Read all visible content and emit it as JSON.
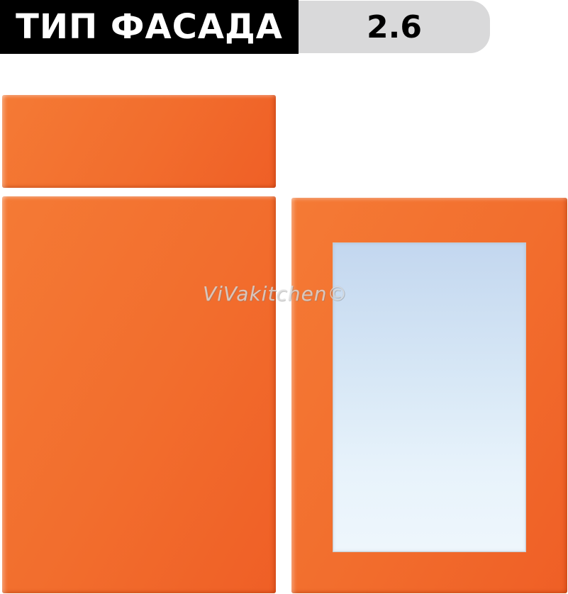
{
  "header": {
    "label": "ТИП ФАСАДА",
    "value": "2.6"
  },
  "watermark": {
    "text": "ViVakitchen©"
  },
  "colors": {
    "panel": "#f26d2d",
    "label_bg": "#000000",
    "value_bg": "#d9d9da",
    "glass": "#d8e8f6"
  }
}
